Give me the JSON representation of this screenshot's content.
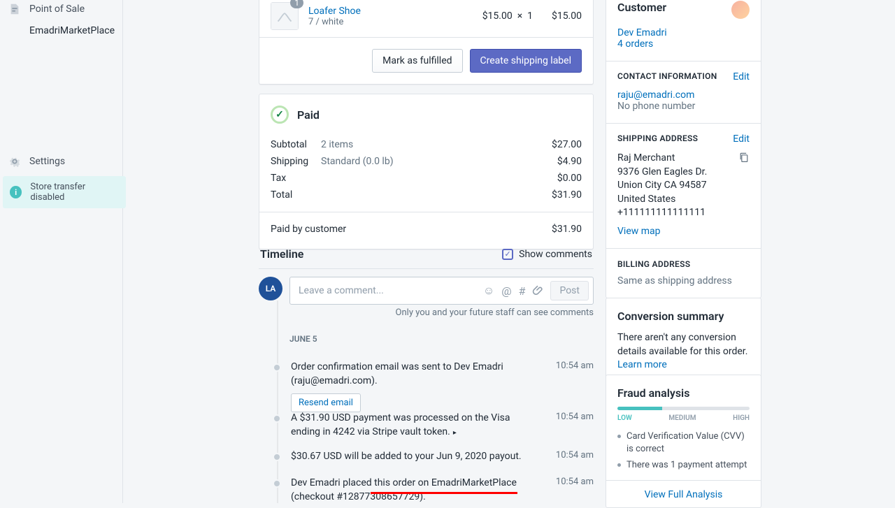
{
  "sidebar": {
    "pos": "Point of Sale",
    "store": "EmadriMarketPlace",
    "settings": "Settings",
    "alert": "Store transfer disabled",
    "alert_badge": "i"
  },
  "product": {
    "badge": "1",
    "name": "Loafer Shoe",
    "variant": "7 / white",
    "unit": "$15.00",
    "x": "×",
    "qty": "1",
    "line": "$15.00",
    "fulfill": "Mark as fulfilled",
    "ship": "Create shipping label"
  },
  "paid": {
    "title": "Paid",
    "rows": [
      {
        "label": "Subtotal",
        "detail": "2 items",
        "amt": "$27.00"
      },
      {
        "label": "Shipping",
        "detail": "Standard (0.0 lb)",
        "amt": "$4.90"
      },
      {
        "label": "Tax",
        "detail": "",
        "amt": "$0.00"
      },
      {
        "label": "Total",
        "detail": "",
        "amt": "$31.90"
      }
    ],
    "paidby": "Paid by customer",
    "paidamt": "$31.90"
  },
  "tl": {
    "title": "Timeline",
    "show": "Show comments",
    "avatar": "LA",
    "placeholder": "Leave a comment...",
    "post": "Post",
    "note": "Only you and your future staff can see comments",
    "date": "JUNE 5",
    "items": [
      {
        "text": "Order confirmation email was sent to Dev Emadri (raju@emadri.com).",
        "time": "10:54 am",
        "action": "Resend email"
      },
      {
        "text": "A $31.90 USD payment was processed on the Visa ending in 4242 via Stripe vault token.",
        "time": "10:54 am",
        "caret": "▸"
      },
      {
        "text": "$30.67 USD will be added to your Jun 9, 2020 payout.",
        "time": "10:54 am"
      },
      {
        "text": "Dev Emadri placed this order on EmadriMarketPlace (checkout #12877308657729).",
        "time": "10:54 am"
      }
    ]
  },
  "customer": {
    "title": "Customer",
    "name": "Dev Emadri",
    "orders": "4 orders",
    "contact_h": "CONTACT INFORMATION",
    "edit": "Edit",
    "email": "raju@emadri.com",
    "phone": "No phone number",
    "ship_h": "SHIPPING ADDRESS",
    "addr": [
      "Raj Merchant",
      "9376 Glen Eagles Dr.",
      "Union City CA 94587",
      "United States",
      "+111111111111111"
    ],
    "viewmap": "View map",
    "bill_h": "BILLING ADDRESS",
    "bill_txt": "Same as shipping address"
  },
  "conv": {
    "title": "Conversion summary",
    "text": "There aren't any conversion details available for this order. ",
    "learn": "Learn more"
  },
  "fraud": {
    "title": "Fraud analysis",
    "low": "LOW",
    "med": "MEDIUM",
    "high": "HIGH",
    "b1": "Card Verification Value (CVV) is correct",
    "b2": "There was 1 payment attempt",
    "vfa": "View Full Analysis"
  }
}
